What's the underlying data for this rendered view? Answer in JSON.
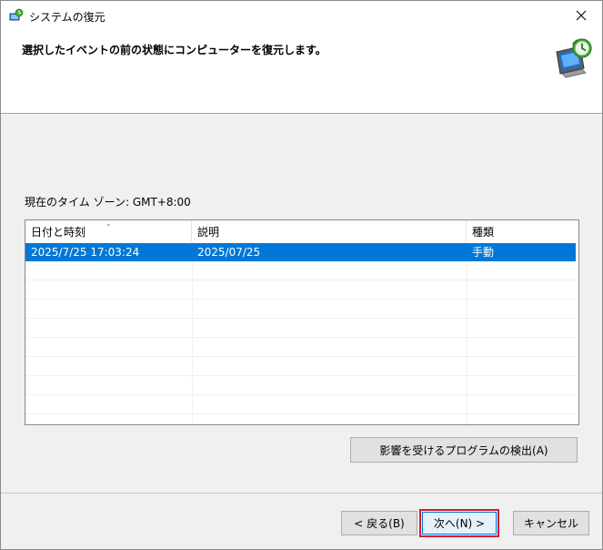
{
  "window": {
    "title": "システムの復元"
  },
  "header": {
    "instruction": "選択したイベントの前の状態にコンピューターを復元します。"
  },
  "timezone_label": "現在のタイム ゾーン: GMT+8:00",
  "table": {
    "columns": [
      "日付と時刻",
      "説明",
      "種類"
    ],
    "rows": [
      {
        "datetime": "2025/7/25 17:03:24",
        "description": "2025/07/25",
        "type": "手動",
        "selected": true
      }
    ]
  },
  "buttons": {
    "scan": "影響を受けるプログラムの検出(A)",
    "back": "< 戻る(B)",
    "next": "次へ(N) >",
    "cancel": "キャンセル"
  },
  "colors": {
    "selection": "#0078d7",
    "highlight_border": "#d11f2f"
  },
  "icons": {
    "title": "system-restore-icon",
    "header": "computer-restore-icon",
    "close": "close-icon"
  }
}
